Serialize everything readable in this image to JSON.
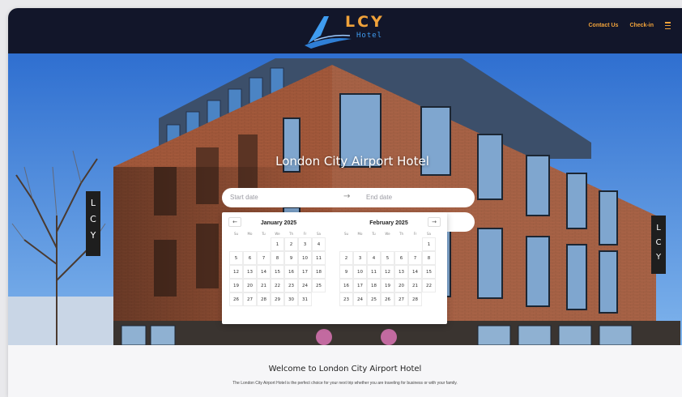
{
  "header": {
    "logo_text": "LCY",
    "logo_subtext": "Hotel",
    "nav": [
      {
        "label": "Contact Us"
      },
      {
        "label": "Check-in"
      }
    ]
  },
  "hero": {
    "title": "London City Airport Hotel",
    "date_picker": {
      "start_placeholder": "Start date",
      "end_placeholder": "End date",
      "prev_label": "←",
      "next_label": "→",
      "weekdays": [
        "Su",
        "Mo",
        "Tu",
        "We",
        "Th",
        "Fr",
        "Sa"
      ],
      "months": [
        {
          "title": "January 2025",
          "days": [
            "",
            "",
            "",
            "1",
            "2",
            "3",
            "4",
            "5",
            "6",
            "7",
            "8",
            "9",
            "10",
            "11",
            "12",
            "13",
            "14",
            "15",
            "16",
            "17",
            "18",
            "19",
            "20",
            "21",
            "22",
            "23",
            "24",
            "25",
            "26",
            "27",
            "28",
            "29",
            "30",
            "31"
          ]
        },
        {
          "title": "February 2025",
          "days": [
            "",
            "",
            "",
            "",
            "",
            "",
            "1",
            "2",
            "3",
            "4",
            "5",
            "6",
            "7",
            "8",
            "9",
            "10",
            "11",
            "12",
            "13",
            "14",
            "15",
            "16",
            "17",
            "18",
            "19",
            "20",
            "21",
            "22",
            "23",
            "24",
            "25",
            "26",
            "27",
            "28"
          ]
        }
      ]
    }
  },
  "welcome": {
    "heading": "Welcome to London City Airport Hotel",
    "text": "The London City Airport Hotel is the perfect choice for your next trip whether you are traveling for business or with your family."
  },
  "colors": {
    "header_bg": "#12162a",
    "accent_orange": "#f0a23a",
    "accent_blue": "#3f9cf0"
  }
}
